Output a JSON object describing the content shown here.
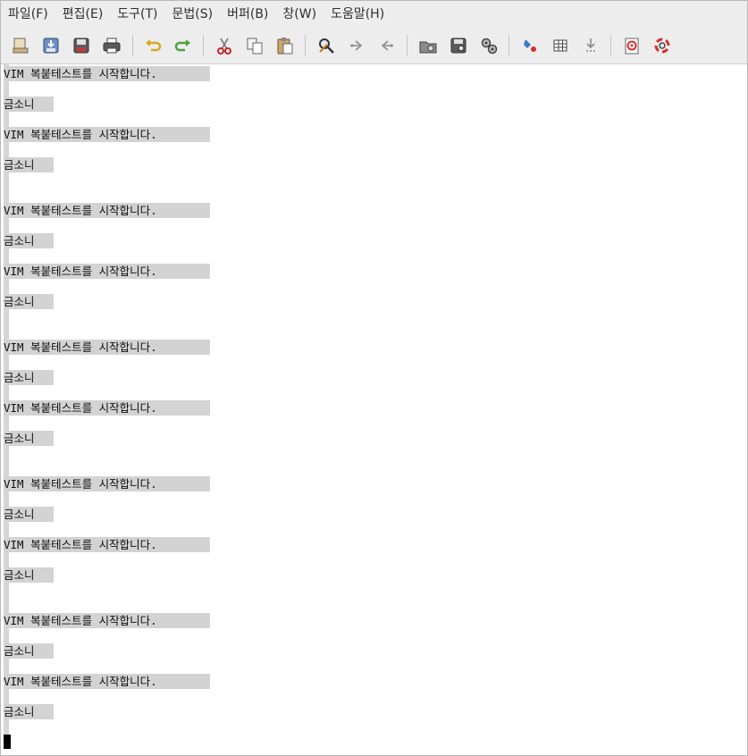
{
  "menu": [
    "파일(F)",
    "편집(E)",
    "도구(T)",
    "문법(S)",
    "버퍼(B)",
    "창(W)",
    "도움말(H)"
  ],
  "toolbar": {
    "icons": [
      "open-icon",
      "save-icon",
      "save-all-icon",
      "print-icon",
      "undo-icon",
      "redo-icon",
      "cut-icon",
      "copy-icon",
      "paste-icon",
      "find-replace-icon",
      "find-next-icon",
      "find-prev-icon",
      "load-session-icon",
      "save-session-icon",
      "run-script-icon",
      "make-icon",
      "tags-icon",
      "jump-tag-icon",
      "help-icon",
      "find-help-icon"
    ]
  },
  "editor": {
    "lines": [
      "VIM 복붙테스트를 시작합니다.",
      "금소니",
      "VIM 복붙테스트를 시작합니다.",
      "금소니",
      "VIM 복붙테스트를 시작합니다.",
      "금소니",
      "VIM 복붙테스트를 시작합니다.",
      "금소니",
      "VIM 복붙테스트를 시작합니다.",
      "금소니",
      "VIM 복붙테스트를 시작합니다.",
      "금소니",
      "VIM 복붙테스트를 시작합니다.",
      "금소니",
      "VIM 복붙테스트를 시작합니다.",
      "금소니",
      "VIM 복붙테스트를 시작합니다.",
      "금소니",
      "VIM 복붙테스트를 시작합니다.",
      "금소니"
    ],
    "selection_color": "#d3d3d3"
  }
}
